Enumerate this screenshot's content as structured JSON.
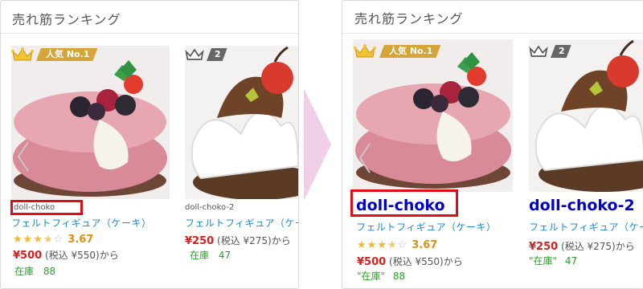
{
  "colors": {
    "accent_blue": "#1a88d8",
    "name_blue": "#0000cc",
    "price_red": "#d81e1e",
    "stock_green": "#2aa22a",
    "rating_orange": "#e28f0b",
    "highlight_red": "#e20c19",
    "arrow_pink": "#f1cfe8",
    "crown_gold": "#f4c430",
    "badge_gold": "#d6a53a",
    "badge_gray": "#666666"
  },
  "before": {
    "title": "売れ筋ランキング",
    "items": [
      {
        "rank_label": "人気 No.1",
        "name": "doll-choko",
        "category": "フェルトフィギュア（ケーキ）",
        "rating": "3.67",
        "price": "¥500",
        "price_tax": "(税込 ¥550)から",
        "stock_label": "在庫",
        "stock": "88",
        "icon": "crown-gold-icon"
      },
      {
        "rank_label": "2",
        "name": "doll-choko-2",
        "category": "フェルトフィギュア（ケー",
        "price": "¥250",
        "price_tax": "(税込 ¥275)から",
        "stock_label": "在庫",
        "stock": "47",
        "icon": "crown-gray-icon"
      }
    ]
  },
  "after": {
    "title": "売れ筋ランキング",
    "items": [
      {
        "rank_label": "人気 No.1",
        "name": "doll-choko",
        "category": "フェルトフィギュア（ケーキ）",
        "rating": "3.67",
        "price": "¥500",
        "price_tax": "(税込 ¥550)から",
        "stock_label": "\"在庫\"",
        "stock": "88",
        "icon": "crown-gold-icon"
      },
      {
        "rank_label": "2",
        "name": "doll-choko-2",
        "category": "フェルトフィギュア（ケー",
        "price": "¥250",
        "price_tax": "(税込 ¥275)から",
        "stock_label": "\"在庫\"",
        "stock": "47",
        "icon": "crown-gray-icon"
      }
    ]
  }
}
